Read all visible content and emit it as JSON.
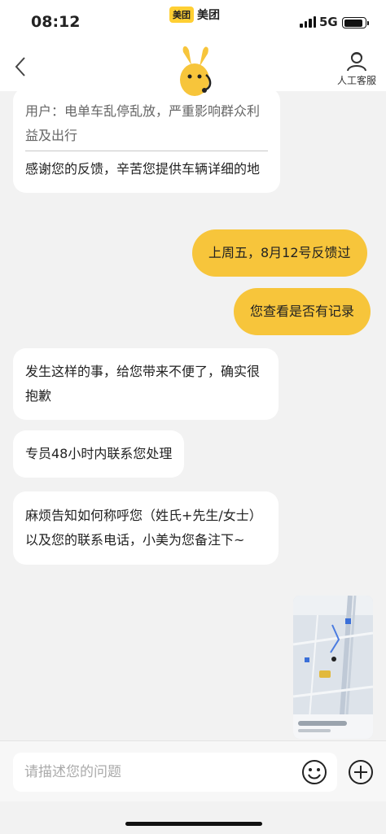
{
  "status_bar": {
    "time": "08:12",
    "app_name": "美团",
    "app_logo": "美团",
    "network": "5G"
  },
  "nav": {
    "service_label": "人工客服",
    "back_icon": "chevron-left-icon",
    "service_icon": "headset-person-icon"
  },
  "messages": [
    {
      "side": "left",
      "quote": "用户：电单车乱停乱放，严重影响群众利益及出行",
      "text": "感谢您的反馈，辛苦您提供车辆详细的地"
    },
    {
      "side": "right",
      "text": "上周五，8月12号反馈过"
    },
    {
      "side": "right",
      "text": "您查看是否有记录"
    },
    {
      "side": "left",
      "text": "发生这样的事，给您带来不便了，确实很抱歉"
    },
    {
      "side": "left",
      "text": "专员48小时内联系您处理"
    },
    {
      "side": "left",
      "text": "麻烦告知如何称呼您（姓氏+先生/女士）以及您的联系电话，小美为您备注下~"
    }
  ],
  "input": {
    "placeholder": "请描述您的问题",
    "value": "",
    "emoji_icon": "smiley-icon",
    "add_icon": "plus-circle-icon"
  },
  "colors": {
    "accent": "#f7c53b",
    "background": "#f2f2f2",
    "bubble_left": "#ffffff"
  }
}
